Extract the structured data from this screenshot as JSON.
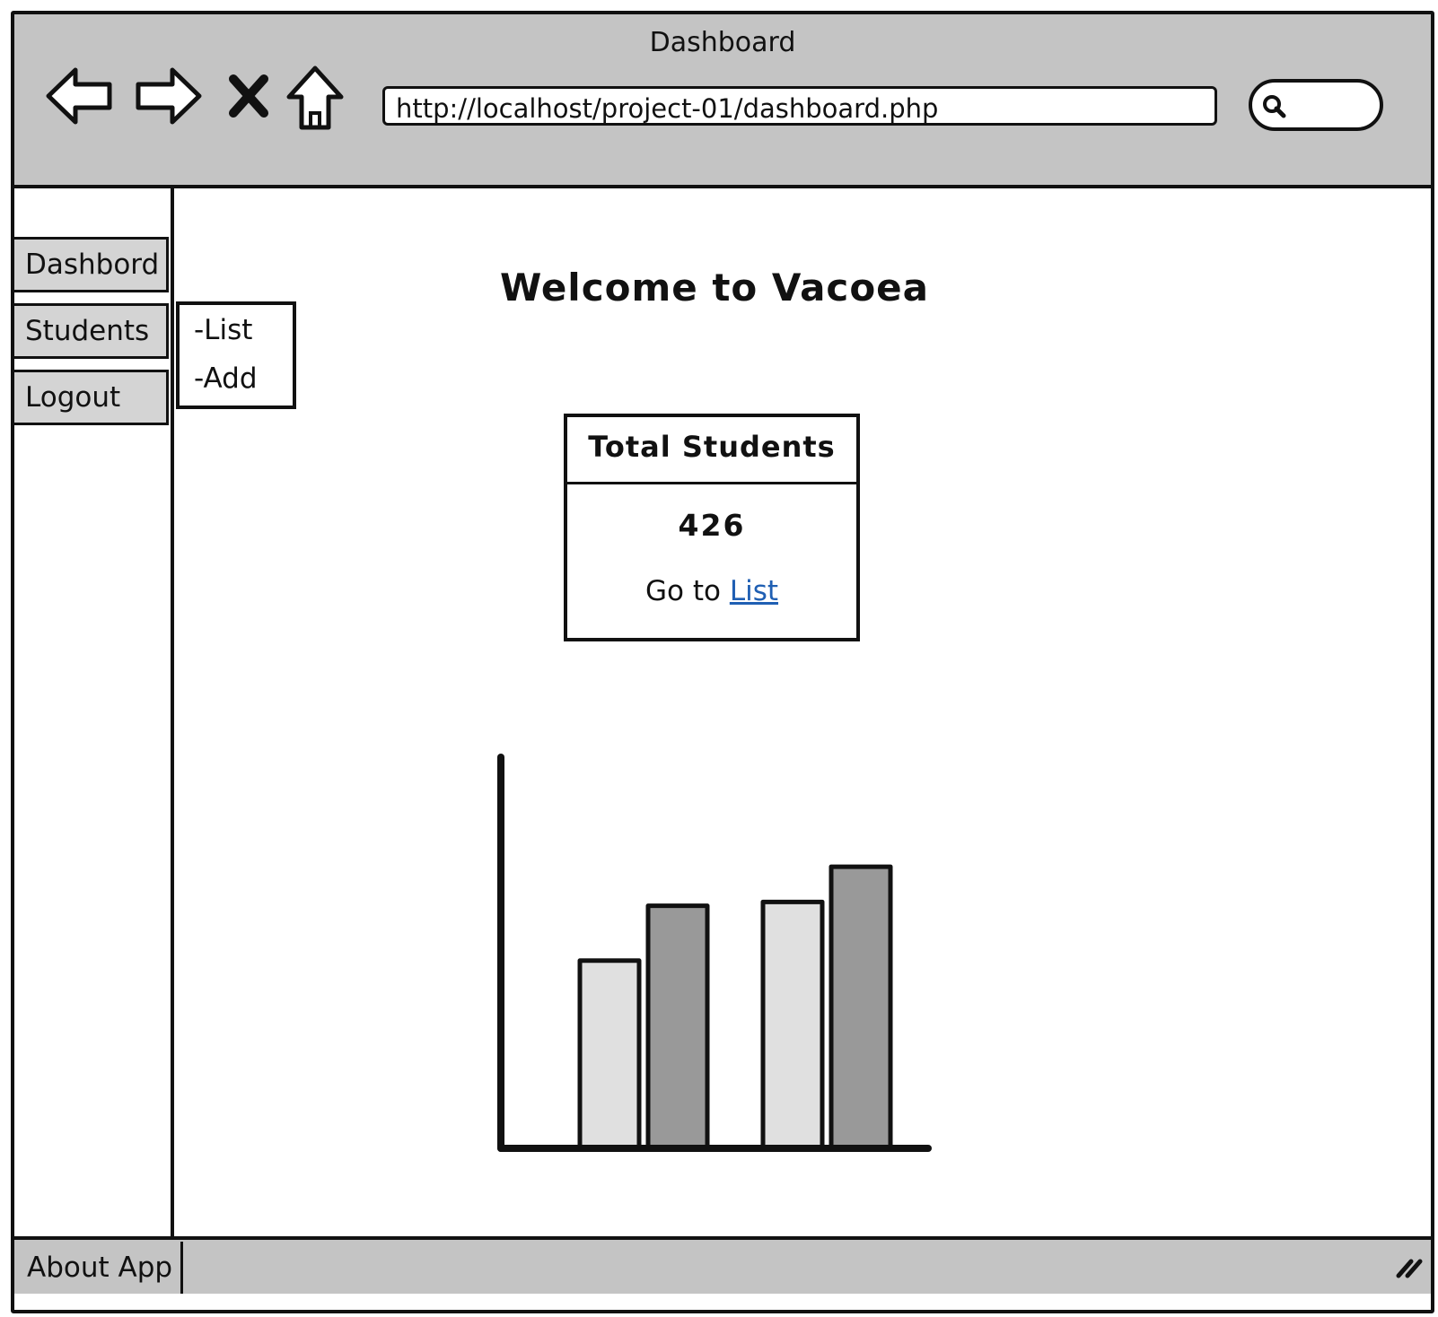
{
  "window": {
    "title": "Dashboard"
  },
  "browser": {
    "url": "http://localhost/project-01/dashboard.php",
    "icons": [
      "back-arrow-icon",
      "forward-arrow-icon",
      "stop-icon",
      "home-icon",
      "search-icon"
    ]
  },
  "sidebar": {
    "items": [
      {
        "label": "Dashbord"
      },
      {
        "label": "Students"
      },
      {
        "label": "Logout"
      }
    ],
    "submenu": [
      {
        "label": "-List"
      },
      {
        "label": "-Add"
      }
    ]
  },
  "main": {
    "welcome": "Welcome to Vacoea",
    "stat_card": {
      "title": "Total Students",
      "value": "426",
      "link_prefix": "Go to",
      "link_label": "List"
    }
  },
  "chart_data": {
    "type": "bar",
    "categories": [
      "",
      ""
    ],
    "series": [
      {
        "values": [
          48,
          63
        ],
        "color": "#e0e0e0"
      },
      {
        "values": [
          62,
          72
        ],
        "color": "#999999"
      }
    ],
    "ylim": [
      0,
      100
    ],
    "grid": false
  },
  "footer": {
    "about_label": "About App"
  },
  "colors": {
    "chrome": "#c4c4c4",
    "sidebar_item": "#d4d4d4",
    "link": "#1f5fb3"
  }
}
